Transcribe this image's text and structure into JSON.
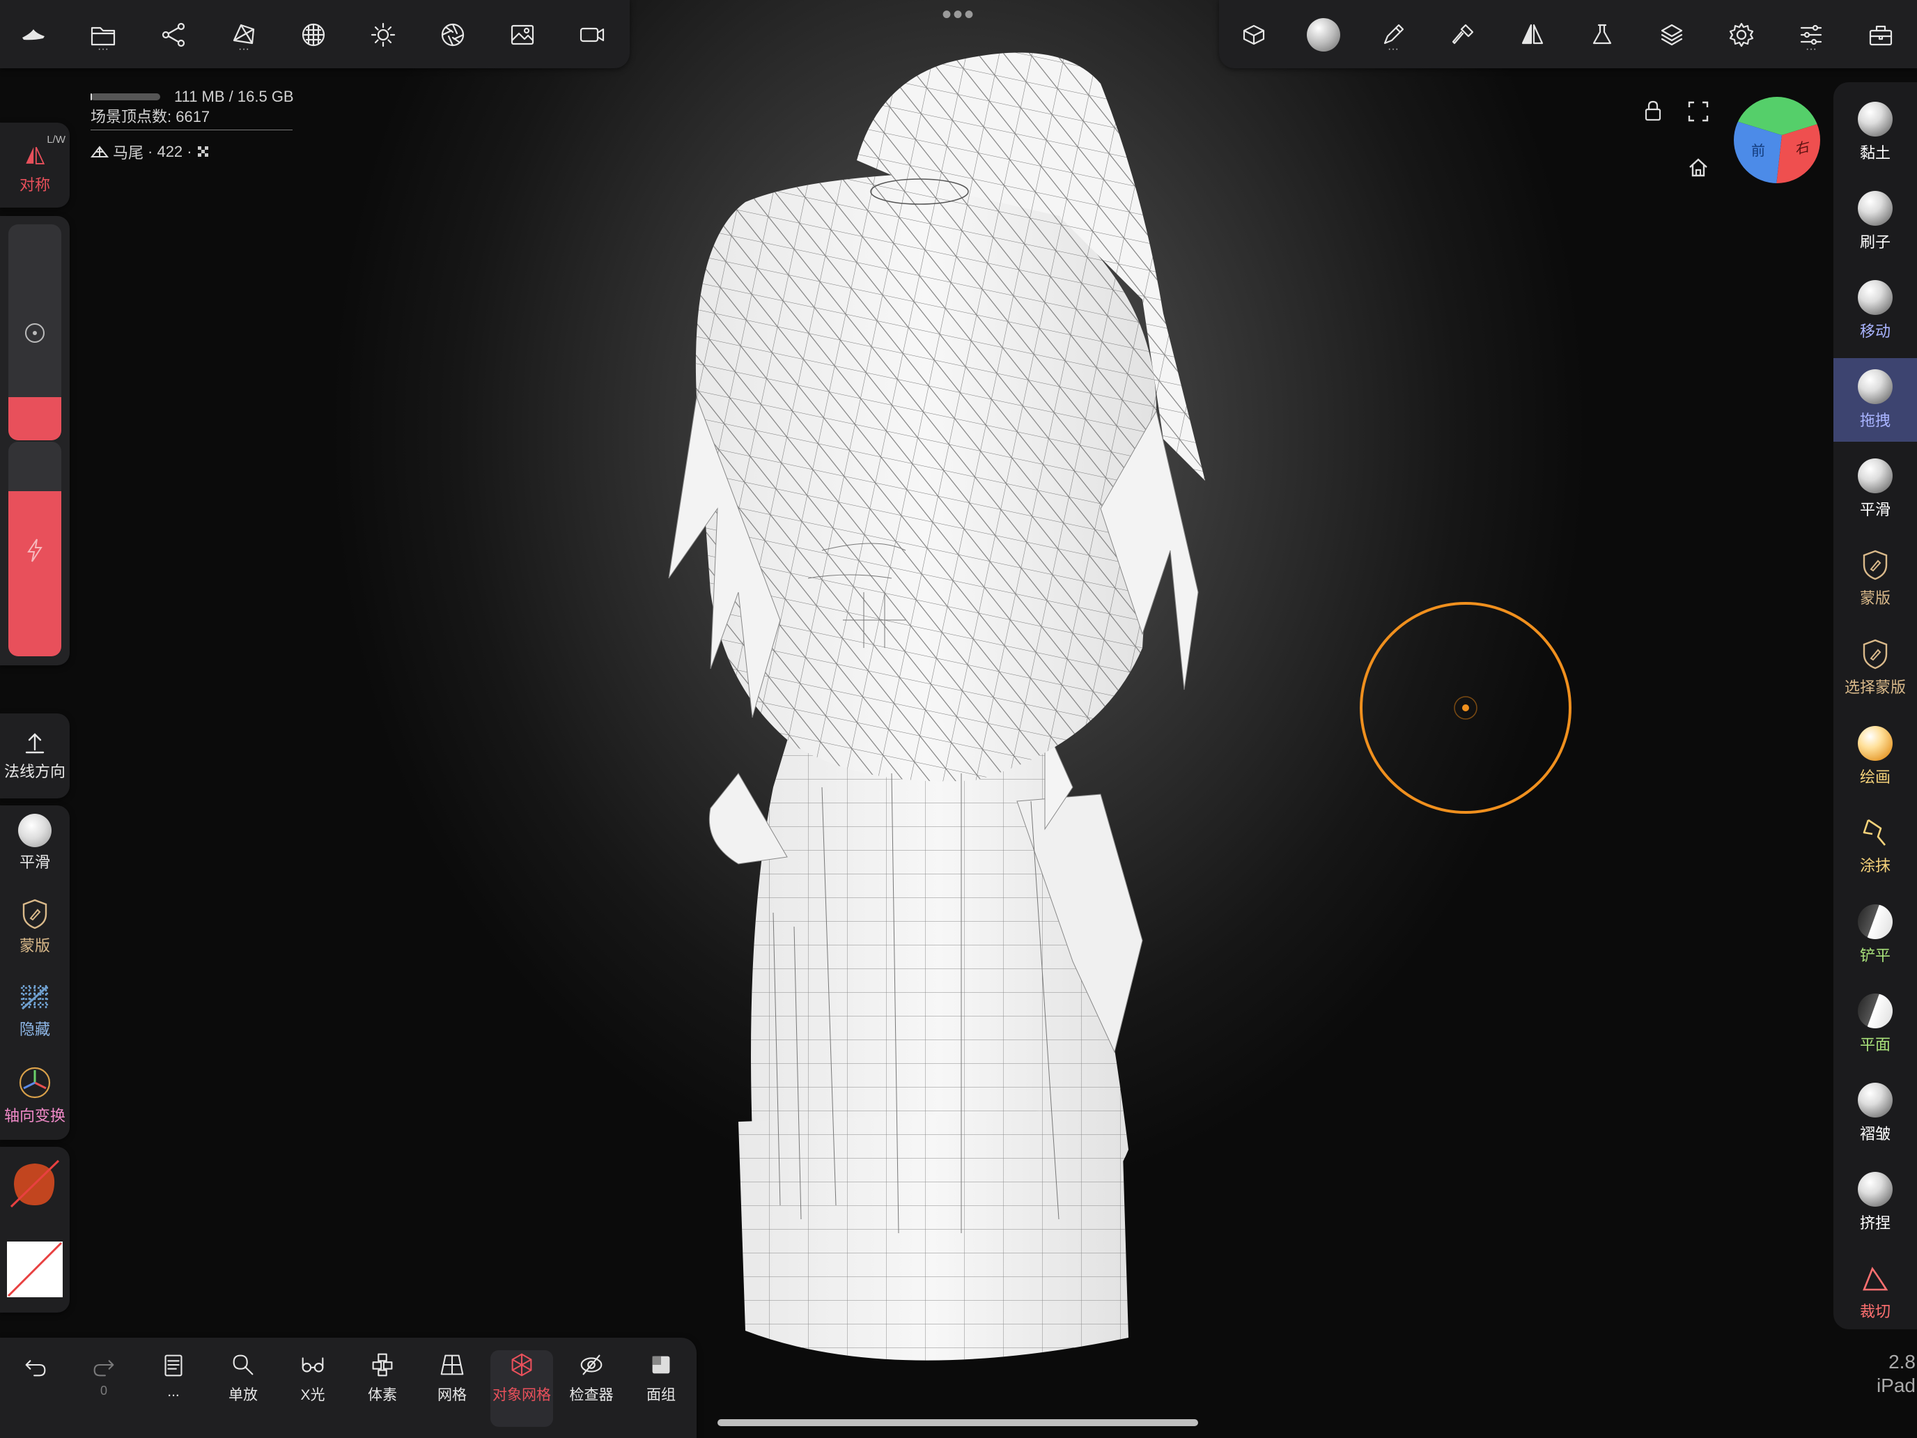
{
  "info": {
    "memory": "111 MB / 16.5 GB",
    "memory_fraction": 0.007,
    "vertex_count": "场景顶点数: 6617",
    "object_name": "马尾",
    "object_detail": "· 422 ·"
  },
  "top_left_toolbar": [
    {
      "icon": "nomad-logo-icon"
    },
    {
      "icon": "folder-icon"
    },
    {
      "icon": "scene-graph-icon"
    },
    {
      "icon": "topology-icon"
    },
    {
      "icon": "material-sphere-icon"
    },
    {
      "icon": "light-sun-icon"
    },
    {
      "icon": "aperture-icon"
    },
    {
      "icon": "background-image-icon"
    },
    {
      "icon": "camera-icon"
    }
  ],
  "top_right_toolbar": [
    {
      "icon": "projection-cube-icon"
    },
    {
      "icon": "material-ball-icon"
    },
    {
      "icon": "stroke-pen-icon"
    },
    {
      "icon": "brush-tool-icon"
    },
    {
      "icon": "symmetry-icon"
    },
    {
      "icon": "flask-icon"
    },
    {
      "icon": "layers-icon"
    },
    {
      "icon": "settings-gear-icon"
    },
    {
      "icon": "sliders-icon"
    },
    {
      "icon": "toolbox-icon"
    }
  ],
  "left_panel": {
    "symmetry_label": "对称",
    "symmetry_badge": "L/W",
    "normal_label": "法线方向",
    "smooth_label": "平滑",
    "mask_label": "蒙版",
    "hide_label": "隐藏",
    "gizmo_label": "轴向变换",
    "radius_fraction": 0.2,
    "intensity_fraction": 0.77
  },
  "right_tools": [
    {
      "label": "黏土",
      "color": "#ffffff"
    },
    {
      "label": "刷子",
      "color": "#ffffff"
    },
    {
      "label": "移动",
      "color": "#a9b4ff"
    },
    {
      "label": "拖拽",
      "color": "#a9b4ff",
      "active": true
    },
    {
      "label": "平滑",
      "color": "#ffffff"
    },
    {
      "label": "蒙版",
      "color": "#d9b98a"
    },
    {
      "label": "选择蒙版",
      "color": "#d9b98a"
    },
    {
      "label": "绘画",
      "color": "#f5d27a"
    },
    {
      "label": "涂抹",
      "color": "#f5d27a"
    },
    {
      "label": "铲平",
      "color": "#a8e07a"
    },
    {
      "label": "平面",
      "color": "#a8e07a"
    },
    {
      "label": "褶皱",
      "color": "#ffffff"
    },
    {
      "label": "挤捏",
      "color": "#ffffff"
    },
    {
      "label": "裁切",
      "color": "#ff7070"
    }
  ],
  "gizmo": {
    "front": "前",
    "right": "右"
  },
  "bottom_bar": {
    "undo_count": "0",
    "items": [
      {
        "label": "单放"
      },
      {
        "label": "X光"
      },
      {
        "label": "体素"
      },
      {
        "label": "网格"
      },
      {
        "label": "对象网格",
        "active": true
      },
      {
        "label": "检查器"
      },
      {
        "label": "面组"
      }
    ],
    "more": "..."
  },
  "version": {
    "number": "2.8",
    "device": "iPad"
  },
  "colors": {
    "accent_red": "#e8505b",
    "brush_ring": "#f0901e",
    "active_tool_bg": "#3d4470"
  }
}
